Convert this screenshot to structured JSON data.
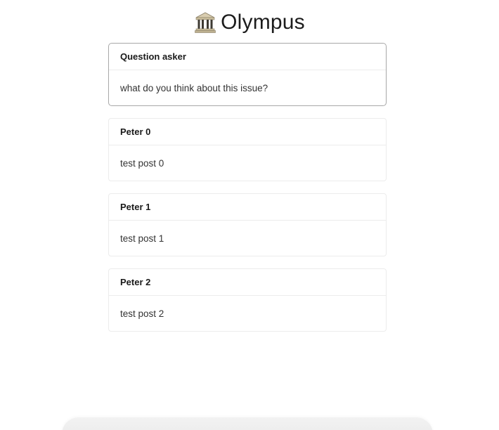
{
  "app": {
    "title": "Olympus",
    "logo_icon": "classical-building-icon"
  },
  "question": {
    "author": "Question asker",
    "text": "what do you think about this issue?"
  },
  "posts": [
    {
      "author": "Peter 0",
      "text": "test post 0"
    },
    {
      "author": "Peter 1",
      "text": "test post 1"
    },
    {
      "author": "Peter 2",
      "text": "test post 2"
    }
  ],
  "colors": {
    "question_border": "#a8a8a8",
    "card_border": "#ececec",
    "background": "#ffffff"
  }
}
